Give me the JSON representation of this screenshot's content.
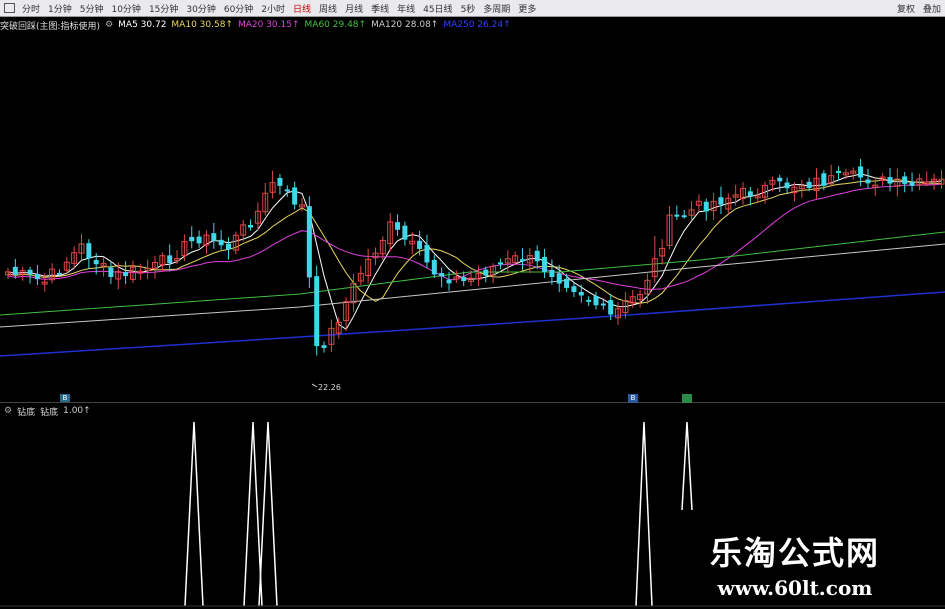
{
  "toolbar": {
    "items": [
      "分时",
      "1分钟",
      "5分钟",
      "10分钟",
      "15分钟",
      "30分钟",
      "60分钟",
      "2小时",
      "日线",
      "周线",
      "月线",
      "季线",
      "年线",
      "45日线",
      "5秒",
      "多周期",
      "更多"
    ],
    "active_index": 8,
    "right_items": [
      "复权",
      "叠加"
    ]
  },
  "mabar": {
    "title": "突破回踩(主图:指标使用)",
    "ma5": "MA5 30.72",
    "ma10": "MA10 30.58↑",
    "ma20": "MA20 30.15↑",
    "ma60": "MA60 29.48↑",
    "ma120": "MA120 28.08↑",
    "ma250": "MA250 26.24↑"
  },
  "price_low_label": "22.26",
  "subbar": {
    "name": "钻底",
    "sub": "钻底",
    "value": "1.00↑"
  },
  "markers": [
    "B",
    "B"
  ],
  "watermark": {
    "title": "乐淘公式网",
    "url": "www.60lt.com"
  },
  "colors": {
    "up": "#e04848",
    "down": "#40d8e8",
    "ma5": "#ffffff",
    "ma10": "#e8d860",
    "ma20": "#e040e0",
    "ma60": "#40c040",
    "ma120": "#c8c8c8",
    "ma250": "#2030d0"
  }
}
